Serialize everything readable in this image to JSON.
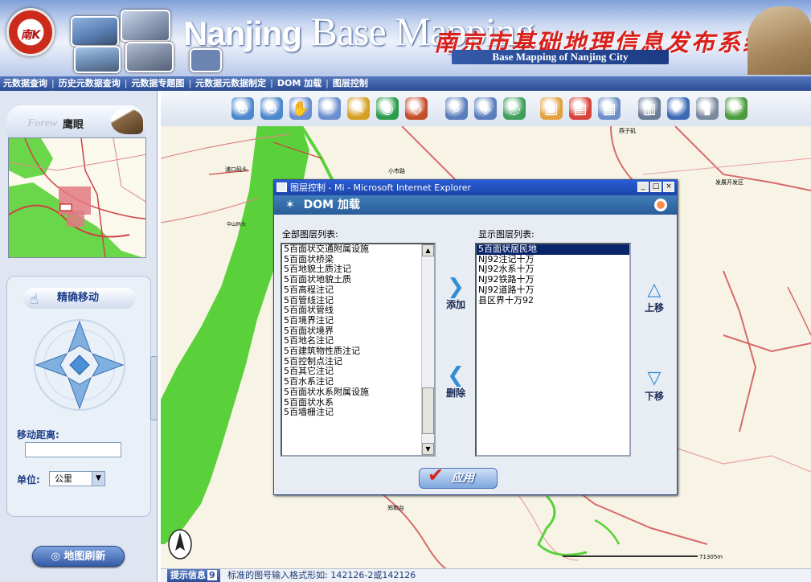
{
  "banner": {
    "logo_text": "南K",
    "title_main": "Nanjing",
    "title_rest": "Base Mapping",
    "title_cn": "南京市基础地理信息发布系统",
    "subtitle_en": "Base Mapping of Nanjing City"
  },
  "menu": {
    "items": [
      "元数据查询",
      "历史元数据查询",
      "元数据专题图",
      "元数据元数据制定",
      "DOM 加载",
      "图层控制"
    ],
    "separator": "|"
  },
  "toolbar": {
    "icons": [
      {
        "name": "zoom-in-icon",
        "glyph": "⊕",
        "color": "#4c88cc"
      },
      {
        "name": "zoom-out-icon",
        "glyph": "⊖",
        "color": "#4c88cc"
      },
      {
        "name": "pan-hand-icon",
        "glyph": "✋",
        "color": "#6a8ed0"
      },
      {
        "name": "select-hand-icon",
        "glyph": "☝",
        "color": "#6a8ed0"
      },
      {
        "name": "measure-ruler-icon",
        "glyph": "✎",
        "color": "#d4a020"
      },
      {
        "name": "globe-icon",
        "glyph": "◉",
        "color": "#2c9c4a"
      },
      {
        "name": "measure-area-icon",
        "glyph": "◇",
        "color": "#c44d2a"
      },
      {
        "name": "query-magnifier-icon",
        "glyph": "⌕",
        "color": "#5a7ebc"
      },
      {
        "name": "identify-icon",
        "glyph": "◈",
        "color": "#5a7ebc"
      },
      {
        "name": "buffer-icon",
        "glyph": "◌",
        "color": "#3d9f5a"
      },
      {
        "name": "select-point-icon",
        "glyph": "▣",
        "color": "#e2a13c"
      },
      {
        "name": "select-rect-icon",
        "glyph": "▤",
        "color": "#d7443a"
      },
      {
        "name": "select-polygon-icon",
        "glyph": "▦",
        "color": "#6e8fc8"
      },
      {
        "name": "print-icon",
        "glyph": "▥",
        "color": "#6a7c98"
      },
      {
        "name": "edit-icon",
        "glyph": "✐",
        "color": "#3c6ab6"
      },
      {
        "name": "delete-icon",
        "glyph": "▮",
        "color": "#7c8aa0"
      },
      {
        "name": "back-icon",
        "glyph": "↩",
        "color": "#4a9c3c"
      }
    ]
  },
  "left_panel": {
    "logo_forward": "Forew",
    "logo_cn": "鹰眼",
    "fine_move_title": "精确移动",
    "move_distance_label": "移动距离:",
    "move_distance_value": "",
    "unit_label": "单位:",
    "unit_selected": "公里",
    "refresh_button": "地图刷新"
  },
  "map_labels": [
    {
      "text": "小市路"
    },
    {
      "text": "燕子矶"
    },
    {
      "text": "中山码头"
    },
    {
      "text": "浦口码头"
    },
    {
      "text": "发展开发区"
    },
    {
      "text": "郑和台"
    },
    {
      "text": "71305m"
    }
  ],
  "dialog": {
    "window_title": "图层控制 - Mi - Microsoft Internet Explorer",
    "header_title": "DOM 加载",
    "all_layers_label": "全部图层列表:",
    "display_layers_label": "显示图层列表:",
    "all_layers": [
      "5百面状交通附属设施",
      "5百面状桥梁",
      "5百地貌土质注记",
      "5百面状地貌土质",
      "5百高程注记",
      "5百管线注记",
      "5百面状管线",
      "5百境界注记",
      "5百面状境界",
      "5百地名注记",
      "5百建筑物性质注记",
      "5百控制点注记",
      "5百其它注记",
      "5百水系注记",
      "5百面状水系附属设施",
      "5百面状水系",
      "5百墙栅注记"
    ],
    "display_layers": [
      "5百面状居民地",
      "NJ92注记十万",
      "NJ92水系十万",
      "NJ92铁路十万",
      "NJ92道路十万",
      "县区界十万92"
    ],
    "selected_display_index": 0,
    "add_button": "添加",
    "remove_button": "删除",
    "move_up_button": "上移",
    "move_down_button": "下移",
    "apply_button": "应用"
  },
  "status": {
    "tag": "提示信息",
    "tag_num": "9",
    "text": "标准的图号输入格式形如: 142126-2或142126"
  },
  "colors": {
    "menubar": "#2c4d96",
    "map_water": "#5ad13a",
    "map_road": "#d86a6a",
    "selection": "#0a246a"
  }
}
